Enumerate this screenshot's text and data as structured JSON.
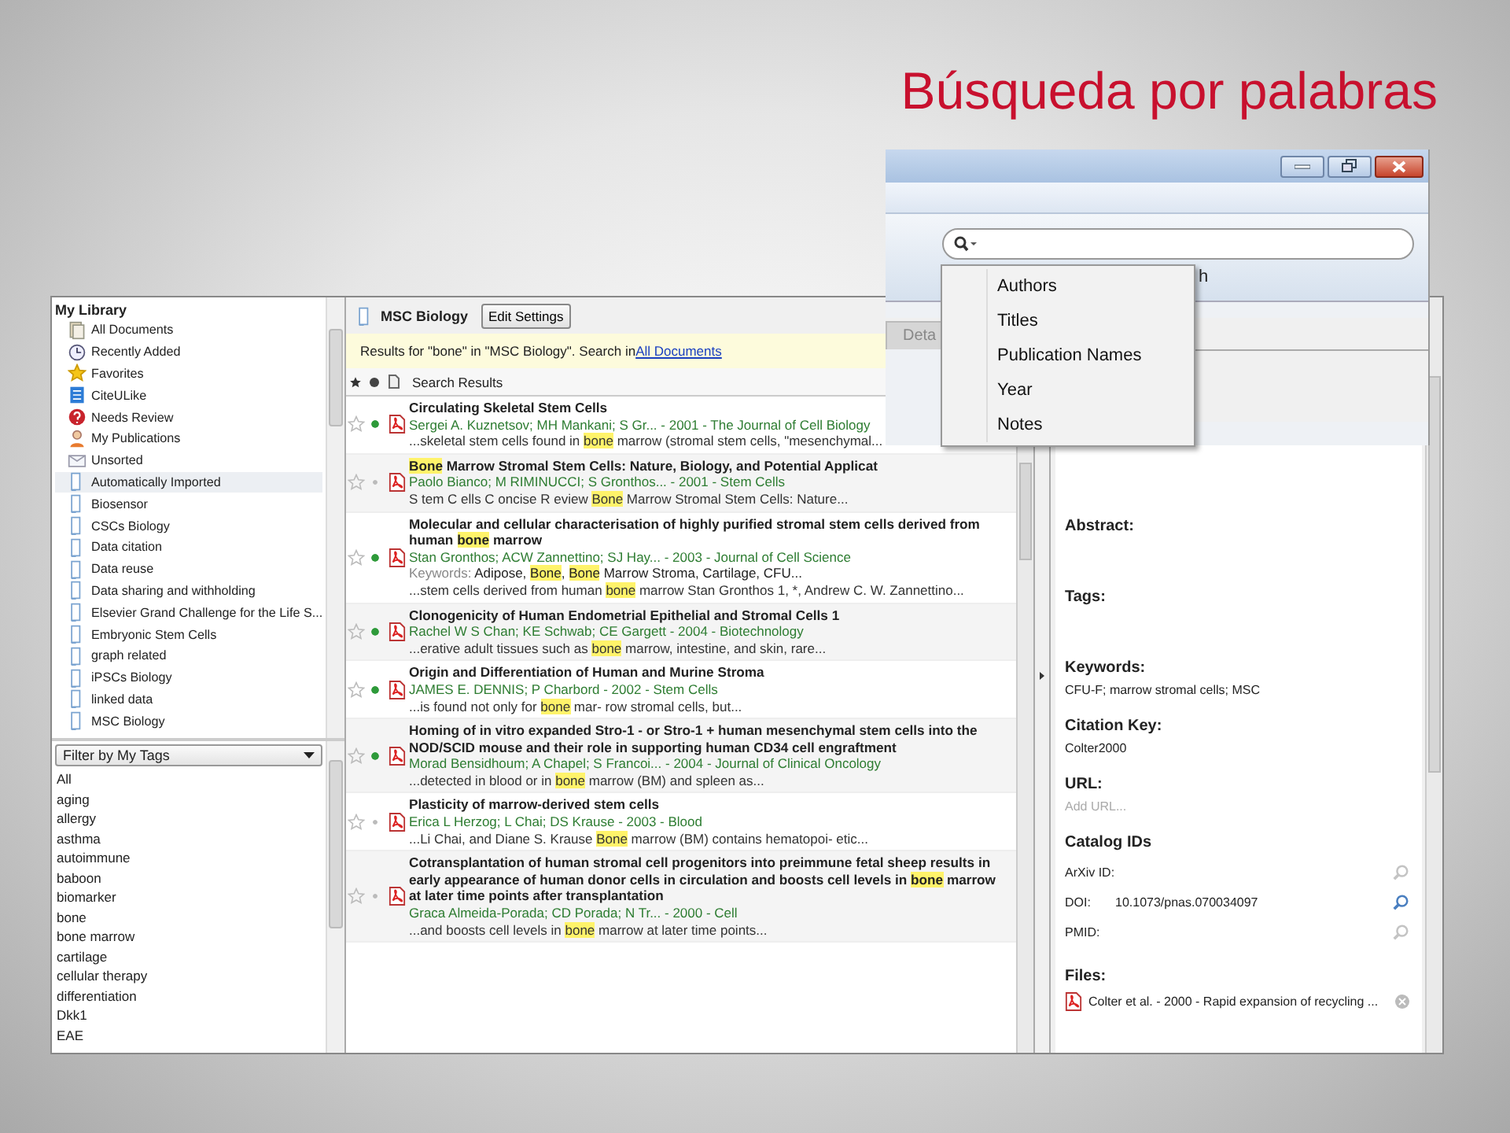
{
  "slide_title": "Búsqueda por palabras",
  "library": {
    "heading": "My Library",
    "items": [
      {
        "label": "All Documents",
        "kind": "documents",
        "selected": false
      },
      {
        "label": "Recently Added",
        "kind": "clock",
        "selected": false
      },
      {
        "label": "Favorites",
        "kind": "star",
        "selected": false
      },
      {
        "label": "CiteULike",
        "kind": "list",
        "selected": false
      },
      {
        "label": "Needs Review",
        "kind": "review",
        "selected": false
      },
      {
        "label": "My Publications",
        "kind": "person",
        "selected": false
      },
      {
        "label": "Unsorted",
        "kind": "tray",
        "selected": false
      },
      {
        "label": "Automatically Imported",
        "kind": "folder",
        "selected": true
      },
      {
        "label": "Biosensor",
        "kind": "folder",
        "selected": false
      },
      {
        "label": "CSCs Biology",
        "kind": "folder",
        "selected": false
      },
      {
        "label": "Data citation",
        "kind": "folder",
        "selected": false
      },
      {
        "label": "Data reuse",
        "kind": "folder",
        "selected": false
      },
      {
        "label": "Data sharing and withholding",
        "kind": "folder",
        "selected": false
      },
      {
        "label": "Elsevier Grand Challenge for the Life S...",
        "kind": "folder",
        "selected": false
      },
      {
        "label": "Embryonic Stem Cells",
        "kind": "folder",
        "selected": false
      },
      {
        "label": "graph related",
        "kind": "folder",
        "selected": false
      },
      {
        "label": "iPSCs Biology",
        "kind": "folder",
        "selected": false
      },
      {
        "label": "linked data",
        "kind": "folder",
        "selected": false
      },
      {
        "label": "MSC Biology",
        "kind": "folder",
        "selected": false
      }
    ]
  },
  "tags": {
    "filter": "Filter by My Tags",
    "items": [
      "All",
      "aging",
      "allergy",
      "asthma",
      "autoimmune",
      "baboon",
      "biomarker",
      "bone",
      "bone marrow",
      "cartilage",
      "cellular therapy",
      "differentiation",
      "Dkk1",
      "EAE"
    ]
  },
  "collection": {
    "name": "MSC Biology",
    "button": "Edit Settings"
  },
  "search_notice": {
    "text": "Results for \"bone\" in \"MSC Biology\". Search in ",
    "link": "All Documents"
  },
  "list_header": "Search Results",
  "results": [
    {
      "unread": true,
      "title": [
        {
          "text": "Circulating Skeletal Stem Cells",
          "highlight": false
        }
      ],
      "authors": "Sergei A. Kuznetsov; MH Mankani; S Gr... - 2001 - The Journal of Cell Biology",
      "snippet": [
        {
          "text": "...skeletal stem cells found in ",
          "highlight": false
        },
        {
          "text": "bone",
          "highlight": true
        },
        {
          "text": " marrow (stromal stem cells, \"mesenchymal...",
          "highlight": false
        }
      ]
    },
    {
      "unread": false,
      "title": [
        {
          "text": "Bone",
          "highlight": true
        },
        {
          "text": " Marrow Stromal Stem Cells: Nature, Biology, and Potential Applicat",
          "highlight": false
        }
      ],
      "authors": "Paolo Bianco; M RIMINUCCI; S Gronthos... - 2001 - Stem Cells",
      "snippet": [
        {
          "text": "S tem C ells C oncise R eview ",
          "highlight": false
        },
        {
          "text": "Bone",
          "highlight": true
        },
        {
          "text": " Marrow Stromal Stem Cells: Nature...",
          "highlight": false
        }
      ]
    },
    {
      "unread": true,
      "title": [
        {
          "text": "Molecular and cellular characterisation of highly purified stromal stem cells derived from human ",
          "highlight": false
        },
        {
          "text": "bone",
          "highlight": true
        },
        {
          "text": " marrow",
          "highlight": false
        }
      ],
      "authors": "Stan Gronthos; ACW Zannettino; SJ Hay... - 2003 - Journal of Cell Science",
      "keywords_label": "Keywords:",
      "keywords": [
        {
          "text": " Adipose, ",
          "highlight": false
        },
        {
          "text": "Bone",
          "highlight": true
        },
        {
          "text": ", ",
          "highlight": false
        },
        {
          "text": "Bone",
          "highlight": true
        },
        {
          "text": " Marrow Stroma, Cartilage, CFU...",
          "highlight": false
        }
      ],
      "snippet": [
        {
          "text": "...stem cells derived from human ",
          "highlight": false
        },
        {
          "text": "bone",
          "highlight": true
        },
        {
          "text": " marrow Stan Gronthos 1, *, Andrew C. W. Zannettino...",
          "highlight": false
        }
      ]
    },
    {
      "unread": true,
      "title": [
        {
          "text": "Clonogenicity of Human Endometrial Epithelial and Stromal Cells 1",
          "highlight": false
        }
      ],
      "authors": "Rachel W S Chan; KE Schwab; CE Gargett - 2004 - Biotechnology",
      "snippet": [
        {
          "text": "...erative adult tissues such as ",
          "highlight": false
        },
        {
          "text": "bone",
          "highlight": true
        },
        {
          "text": " marrow, intestine, and skin, rare...",
          "highlight": false
        }
      ]
    },
    {
      "unread": true,
      "title": [
        {
          "text": "Origin and Differentiation of Human and Murine Stroma",
          "highlight": false
        }
      ],
      "authors": "JAMES E. DENNIS; P Charbord - 2002 - Stem Cells",
      "snippet": [
        {
          "text": "...is found not only for ",
          "highlight": false
        },
        {
          "text": "bone",
          "highlight": true
        },
        {
          "text": " mar- row stromal cells, but...",
          "highlight": false
        }
      ]
    },
    {
      "unread": true,
      "title": [
        {
          "text": "Homing of in vitro expanded Stro-1 - or Stro-1 + human mesenchymal stem cells into the NOD/SCID mouse and their role in supporting human CD34 cell engraftment",
          "highlight": false
        }
      ],
      "authors": "Morad Bensidhoum; A Chapel; S Francoi... - 2004 - Journal of Clinical Oncology",
      "snippet": [
        {
          "text": "...detected in blood or in ",
          "highlight": false
        },
        {
          "text": "bone",
          "highlight": true
        },
        {
          "text": " marrow (BM) and spleen as...",
          "highlight": false
        }
      ]
    },
    {
      "unread": false,
      "title": [
        {
          "text": "Plasticity of marrow-derived stem cells",
          "highlight": false
        }
      ],
      "authors": "Erica L Herzog; L Chai; DS Krause - 2003 - Blood",
      "snippet": [
        {
          "text": "...Li Chai, and Diane S. Krause ",
          "highlight": false
        },
        {
          "text": "Bone",
          "highlight": true
        },
        {
          "text": " marrow (BM) contains hematopoi- etic...",
          "highlight": false
        }
      ]
    },
    {
      "unread": false,
      "title": [
        {
          "text": "Cotransplantation of human stromal cell progenitors into preimmune fetal sheep results in early appearance of human donor cells in circulation and boosts cell levels in ",
          "highlight": false
        },
        {
          "text": "bone",
          "highlight": true
        },
        {
          "text": " marrow at later time points after transplantation",
          "highlight": false
        }
      ],
      "authors": "Graca Almeida-Porada; CD Porada; N Tr... - 2000 - Cell",
      "snippet": [
        {
          "text": "...and boosts cell levels in ",
          "highlight": false
        },
        {
          "text": "bone",
          "highlight": true
        },
        {
          "text": " marrow at later time points...",
          "highlight": false
        }
      ]
    }
  ],
  "details": {
    "sections": [
      {
        "kind": "empty",
        "heading": "Abstract:"
      },
      {
        "kind": "empty",
        "heading": "Tags:"
      },
      {
        "kind": "text",
        "heading": "Keywords:",
        "value": "CFU-F; marrow stromal cells; MSC"
      },
      {
        "kind": "text",
        "heading": "Citation Key:",
        "value": "Colter2000"
      },
      {
        "kind": "field",
        "heading": "URL:",
        "placeholder": "Add URL..."
      },
      {
        "kind": "ids",
        "heading": "Catalog IDs",
        "ids": [
          {
            "label": "ArXiv ID:"
          },
          {
            "label": "DOI:",
            "value": "10.1073/pnas.070034097"
          },
          {
            "label": "PMID:"
          }
        ]
      },
      {
        "kind": "files",
        "heading": "Files:",
        "files": [
          "Colter et al. - 2000 - Rapid expansion of recycling ..."
        ]
      }
    ]
  },
  "search_window": {
    "tab": "Deta",
    "button_fragment": "h",
    "menu": [
      "Authors",
      "Titles",
      "Publication Names",
      "Year",
      "Notes"
    ]
  }
}
